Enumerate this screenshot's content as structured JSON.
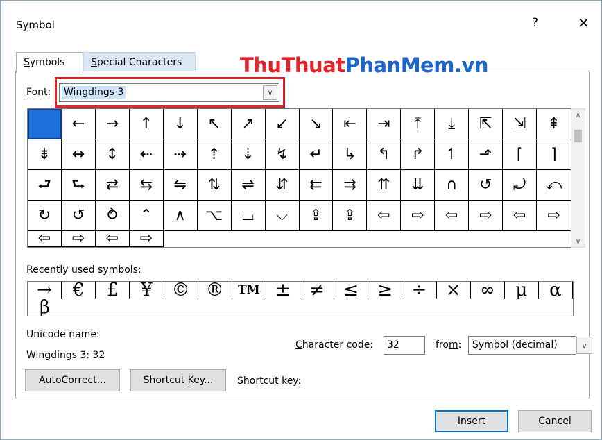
{
  "dialog": {
    "title": "Symbol",
    "help": "?",
    "close": "✕"
  },
  "tabs": [
    {
      "pre": "",
      "key": "S",
      "post": "ymbols"
    },
    {
      "pre": "",
      "key": "S",
      "post": "pecial Characters"
    }
  ],
  "watermark": {
    "part1": "ThuThuat",
    "part2": "PhanMem.vn"
  },
  "font": {
    "label_key": "F",
    "label_post": "ont:",
    "value": "Wingdings 3"
  },
  "symbols": [
    "",
    "←",
    "→",
    "↑",
    "↓",
    "↖",
    "↗",
    "↙",
    "↘",
    "⇤",
    "⇥",
    "⤒",
    "⤓",
    "⇱",
    "⇲",
    "⇞",
    "⇟",
    "↔",
    "↕",
    "⇠",
    "⇢",
    "⇡",
    "⇣",
    "↯",
    "↵",
    "↳",
    "↰",
    "↱",
    "↿",
    "⬏",
    "⌈",
    "⌉",
    "⮐",
    "⮑",
    "⇄",
    "⇆",
    "⇋",
    "⇅",
    "⇌",
    "⇵",
    "⇇",
    "⇉",
    "⇈",
    "⇊",
    "∩",
    "↺",
    "⤾",
    "⤺",
    "↻",
    "↺",
    "⥁",
    "⌃",
    "∧",
    "⌥",
    "⌴",
    "⌵",
    "⇪",
    "⇪",
    "⇦",
    "⇨",
    "⇦",
    "⇨",
    "⇦",
    "⇨",
    "⇦",
    "⇨",
    "⇦",
    "⇨"
  ],
  "recent_label": "Recently used symbols:",
  "recent": [
    "→",
    "€",
    "£",
    "¥",
    "©",
    "®",
    "TM",
    "±",
    "≠",
    "≤",
    "≥",
    "÷",
    "×",
    "∞",
    "μ",
    "α",
    "β"
  ],
  "unicode": {
    "label": "Unicode name:",
    "value": "Wingdings 3: 32"
  },
  "char_code": {
    "label_key": "C",
    "label_post": "haracter code:",
    "value": "32"
  },
  "from": {
    "label_pre": "fro",
    "label_key": "m",
    "label_post": ":",
    "value": "Symbol (decimal)"
  },
  "buttons": {
    "autocorrect_key": "A",
    "autocorrect_post": "utoCorrect...",
    "shortcut_pre": "Shortcut ",
    "shortcut_key": "K",
    "shortcut_post": "ey...",
    "insert_key": "I",
    "insert_post": "nsert",
    "cancel": "Cancel"
  },
  "shortcut_key_label": "Shortcut key:"
}
